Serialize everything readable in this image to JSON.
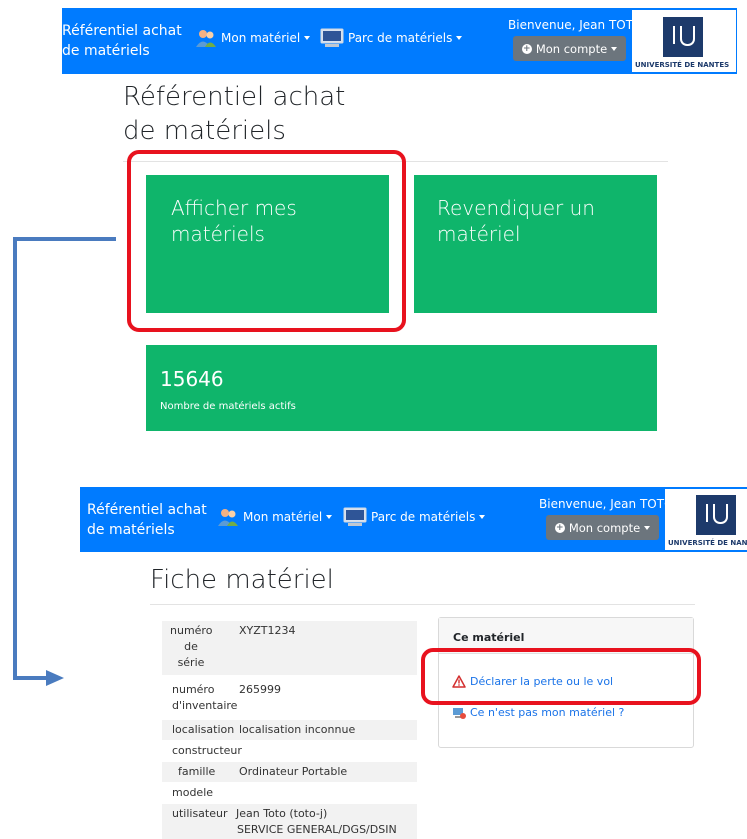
{
  "top_screen": {
    "navbar": {
      "brand_line1": "Référentiel achat",
      "brand_line2": "de matériels",
      "menu_mon_materiel": "Mon matériel",
      "menu_parc": "Parc de matériels",
      "welcome": "Bienvenue, Jean TOTO",
      "account_button": "Mon compte",
      "logo_text": "UNIVERSITÉ DE NANTES"
    },
    "page_title_line1": "Référentiel achat",
    "page_title_line2": "de matériels",
    "tile_afficher_line1": "Afficher mes",
    "tile_afficher_line2": "matériels",
    "tile_revendiquer_line1": "Revendiquer un",
    "tile_revendiquer_line2": "matériel",
    "stats_count": "15646",
    "stats_label": "Nombre de matériels actifs"
  },
  "bottom_screen": {
    "navbar": {
      "brand_line1": "Référentiel achat",
      "brand_line2": "de matériels",
      "menu_mon_materiel": "Mon matériel",
      "menu_parc": "Parc de matériels",
      "welcome": "Bienvenue, Jean TOTO",
      "account_button": "Mon compte",
      "logo_text": "UNIVERSITÉ DE NANTES"
    },
    "page_title": "Fiche matériel",
    "fields": [
      {
        "label": "numéro de série",
        "value": "XYZT1234"
      },
      {
        "label": "numéro d'inventaire",
        "value": "265999"
      },
      {
        "label": "localisation",
        "value": "localisation inconnue"
      },
      {
        "label": "constructeur",
        "value": ""
      },
      {
        "label": "famille",
        "value": "Ordinateur Portable"
      },
      {
        "label": "modele",
        "value": ""
      },
      {
        "label": "utilisateur",
        "value": "Jean Toto (toto-j)",
        "value_line2": "SERVICE GENERAL/DGS/DSIN"
      }
    ],
    "card": {
      "title": "Ce matériel",
      "link_declare": "Déclarer la perte ou le vol",
      "link_not_mine": "Ce n'est pas mon matériel ?"
    }
  },
  "colors": {
    "navbar": "#007bff",
    "tile": "#0fb56b",
    "highlight": "#e8121e",
    "arrow": "#4a7bbf"
  }
}
